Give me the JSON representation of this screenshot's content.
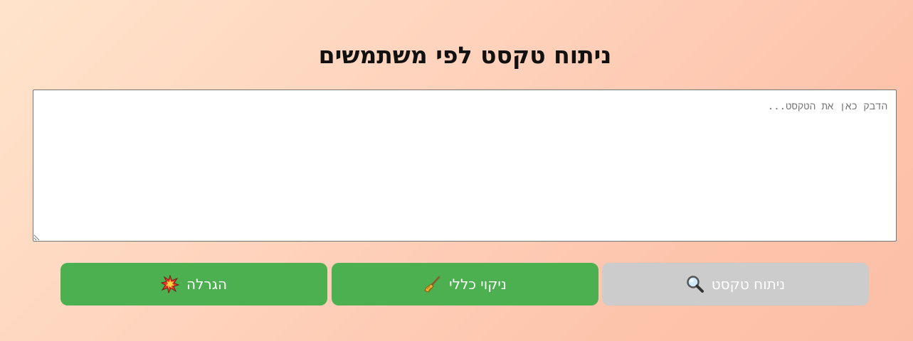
{
  "page": {
    "title": "ניתוח טקסט לפי משתמשים"
  },
  "editor": {
    "placeholder": "הדבק כאן את הטקסט...",
    "value": ""
  },
  "buttons": {
    "analyze": {
      "label": "ניתוח טקסט",
      "icon": "magnifier-icon",
      "color": "#cccccc",
      "enabled": false
    },
    "clear": {
      "label": "ניקוי כללי",
      "icon": "broom-icon",
      "color": "#4caf50"
    },
    "raffle": {
      "label": "הגרלה",
      "icon": "collision-icon",
      "color": "#4caf50"
    }
  }
}
